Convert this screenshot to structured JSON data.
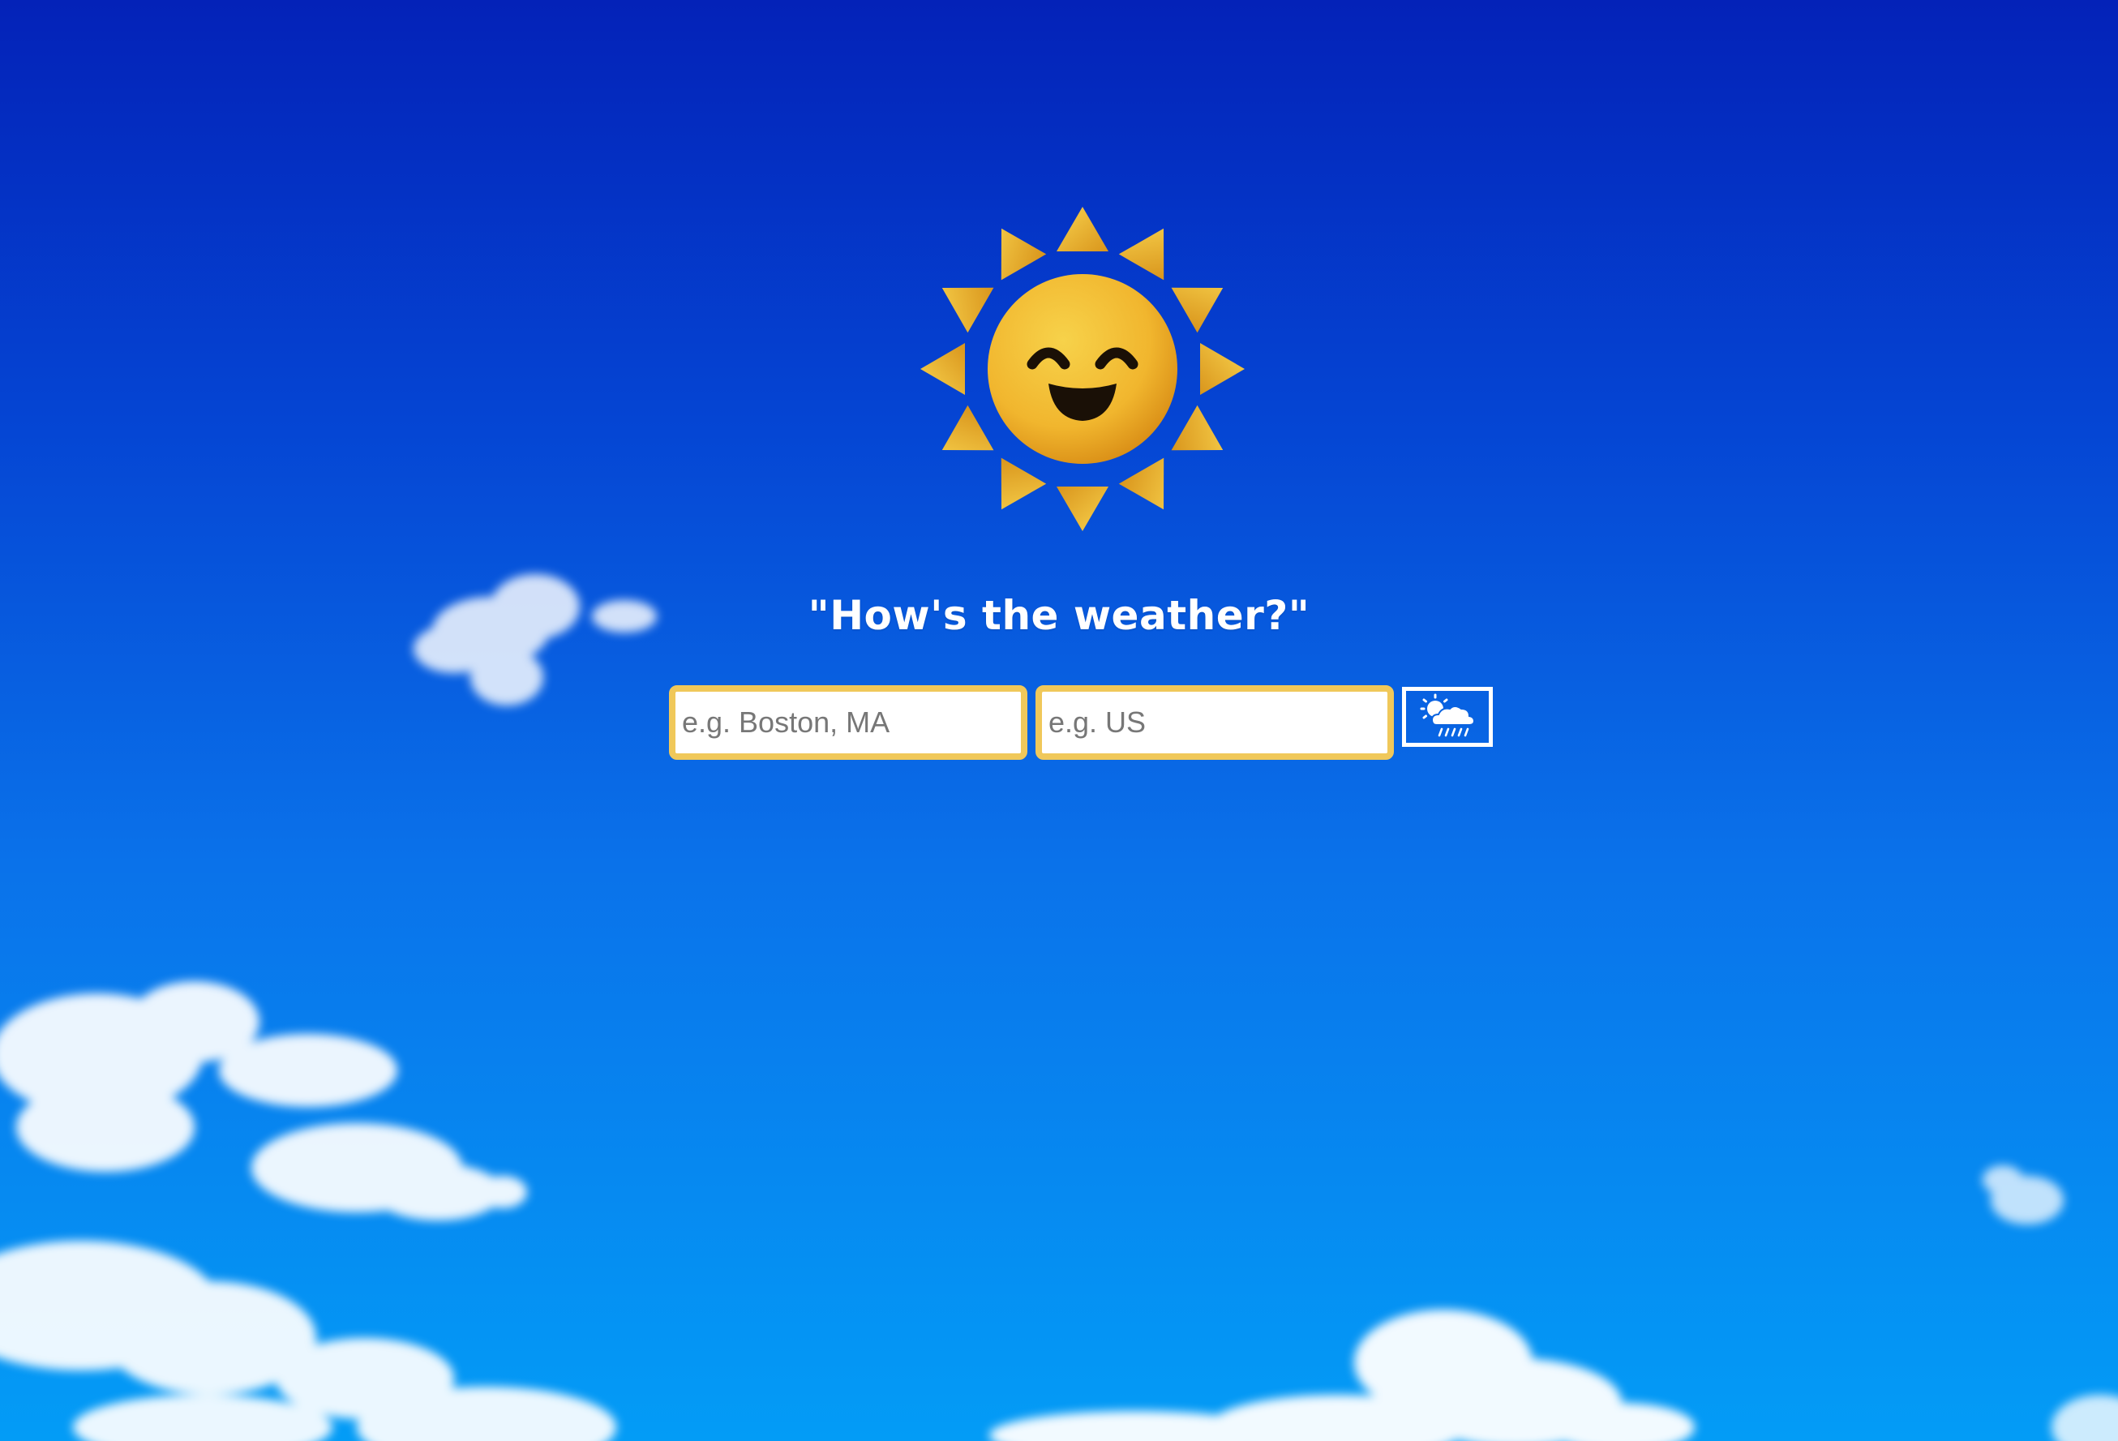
{
  "heading": "\"How's the weather?\"",
  "search": {
    "city_placeholder": "e.g. Boston, MA",
    "country_placeholder": "e.g. US",
    "submit_icon": "sun-cloud-rain-icon"
  },
  "colors": {
    "sky_top": "#0422b8",
    "sky_bottom": "#039cf6",
    "field_border": "#f0c85a",
    "sun": "#f3b52f",
    "text": "#ffffff"
  },
  "icons": {
    "sun_mascot": "smiling-sun-icon"
  }
}
